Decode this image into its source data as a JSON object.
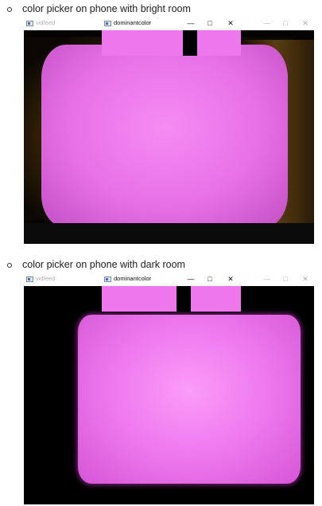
{
  "items": [
    {
      "caption": "color picker on phone with bright room",
      "vidfeed_title": "vidfeed",
      "dominant_title": "dominantcolor",
      "controls": {
        "minimize": "—",
        "maximize": "□",
        "close": "✕"
      }
    },
    {
      "caption": "color picker on phone with dark room",
      "vidfeed_title": "vidfeed",
      "dominant_title": "dominantcolor",
      "controls": {
        "minimize": "—",
        "maximize": "□",
        "close": "✕"
      }
    }
  ],
  "colors": {
    "dominant_swatch": "#ee77ee",
    "screen_magenta": "#e66be6",
    "feed_background": "#000000"
  }
}
